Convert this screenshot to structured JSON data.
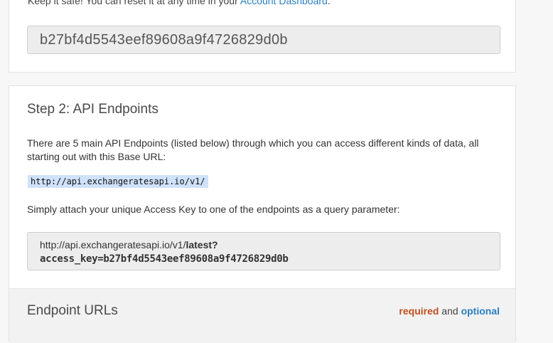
{
  "step1": {
    "intro_prefix": "Keep it safe! You can reset it at any time in your ",
    "dashboard_link": "Account Dashboard",
    "intro_suffix": ".",
    "access_key": "b27bf4d5543eef89608a9f4726829d0b"
  },
  "step2": {
    "title": "Step 2: API Endpoints",
    "description": "There are 5 main API Endpoints (listed below) through which you can access different kinds of data, all starting out with this Base URL:",
    "base_url": "http://api.exchangeratesapi.io/v1/",
    "attach_text": "Simply attach your unique Access Key to one of the endpoints as a query parameter:",
    "example": {
      "url_prefix": "http://api.exchangeratesapi.io/v1/",
      "endpoint": "latest?",
      "param": "access_key=b27bf4d5543eef89608a9f4726829d0b"
    }
  },
  "endpoints_section": {
    "title": "Endpoint URLs",
    "legend_required": "required",
    "legend_and": " and ",
    "legend_optional": "optional"
  },
  "colors": {
    "required": "#c0501f",
    "optional": "#2a7fc1",
    "code_highlight": "#cfe2fb"
  }
}
